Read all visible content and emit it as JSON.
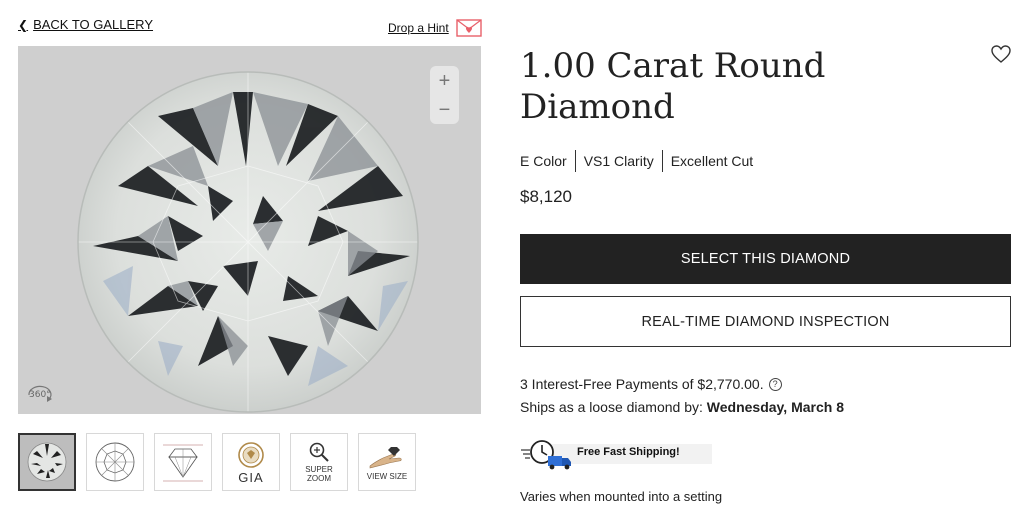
{
  "nav": {
    "back_label": "BACK TO GALLERY"
  },
  "hint": {
    "label": "Drop a Hint"
  },
  "viewer": {
    "zoom_in": "+",
    "zoom_out": "−",
    "rotate_label": "360°"
  },
  "thumbnails": [
    {
      "label": "",
      "icon": "diamond-photo-icon",
      "active": true
    },
    {
      "label": "",
      "icon": "diamond-top-diagram-icon"
    },
    {
      "label": "",
      "icon": "diamond-profile-diagram-icon"
    },
    {
      "label": "GIA",
      "icon": "gia-certificate-icon"
    },
    {
      "label": "SUPER ZOOM",
      "icon": "magnifier-icon"
    },
    {
      "label": "VIEW SIZE",
      "icon": "hand-size-icon"
    }
  ],
  "product": {
    "title": "1.00 Carat Round Diamond",
    "specs": [
      "E Color",
      "VS1 Clarity",
      "Excellent Cut"
    ],
    "price": "$8,120"
  },
  "actions": {
    "select_label": "SELECT THIS DIAMOND",
    "inspect_label": "REAL-TIME DIAMOND INSPECTION"
  },
  "payment": {
    "text": "3 Interest-Free Payments of $2,770.00."
  },
  "shipping": {
    "ships_prefix": "Ships as a loose diamond by: ",
    "ships_date": "Wednesday, March 8",
    "badge_label": "Free Fast Shipping!",
    "note": "Varies when mounted into a setting"
  },
  "colors": {
    "primary_button": "#222222",
    "accent_hint": "#e8606a",
    "viewer_bg": "#cfcfcf"
  }
}
